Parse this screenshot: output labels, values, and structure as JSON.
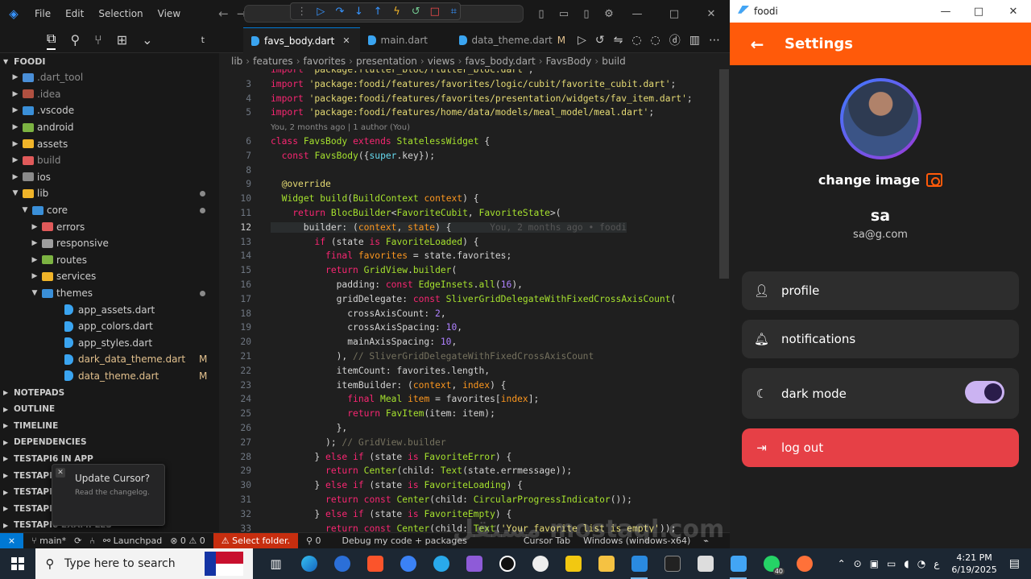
{
  "titlebar": {
    "menu": [
      "File",
      "Edit",
      "Selection",
      "View"
    ]
  },
  "sidebar": {
    "project": "FOODI",
    "tree": [
      {
        "label": ".dart_tool",
        "depth": 1,
        "type": "folder",
        "color": "#4a8fd8",
        "dim": true
      },
      {
        "label": ".idea",
        "depth": 1,
        "type": "folder",
        "color": "#b05040",
        "dim": true
      },
      {
        "label": ".vscode",
        "depth": 1,
        "type": "folder",
        "color": "#3a8fd8"
      },
      {
        "label": "android",
        "depth": 1,
        "type": "folder",
        "color": "#7cb342"
      },
      {
        "label": "assets",
        "depth": 1,
        "type": "folder",
        "color": "#f0b429"
      },
      {
        "label": "build",
        "depth": 1,
        "type": "folder",
        "color": "#e05a5a",
        "dim": true
      },
      {
        "label": "ios",
        "depth": 1,
        "type": "folder",
        "color": "#8a8a8a"
      },
      {
        "label": "lib",
        "depth": 1,
        "type": "folder-open",
        "color": "#f0b429",
        "dot": true
      },
      {
        "label": "core",
        "depth": 2,
        "type": "folder-open",
        "color": "#3a8fd8",
        "dot": true
      },
      {
        "label": "errors",
        "depth": 3,
        "type": "folder",
        "color": "#e05a5a"
      },
      {
        "label": "responsive",
        "depth": 3,
        "type": "folder",
        "color": "#9e9e9e"
      },
      {
        "label": "routes",
        "depth": 3,
        "type": "folder",
        "color": "#7cb342"
      },
      {
        "label": "services",
        "depth": 3,
        "type": "folder",
        "color": "#f0b429"
      },
      {
        "label": "themes",
        "depth": 3,
        "type": "folder-open",
        "color": "#3a8fd8",
        "dot": true
      },
      {
        "label": "app_assets.dart",
        "depth": 4,
        "type": "dart"
      },
      {
        "label": "app_colors.dart",
        "depth": 4,
        "type": "dart"
      },
      {
        "label": "app_styles.dart",
        "depth": 4,
        "type": "dart"
      },
      {
        "label": "dark_data_theme.dart",
        "depth": 4,
        "type": "dart",
        "mod": "M"
      },
      {
        "label": "data_theme.dart",
        "depth": 4,
        "type": "dart",
        "mod": "M"
      }
    ],
    "sections": [
      "NOTEPADS",
      "OUTLINE",
      "TIMELINE",
      "DEPENDENCIES",
      "TESTAPI6 IN APP",
      "TESTAPI6 PROFILE",
      "TESTAPI6 HISTORY",
      "TESTAPI6",
      "TESTAPI6 EXAMPLES"
    ]
  },
  "notification": {
    "title": "Update Cursor?",
    "subtitle": "Read the changelog."
  },
  "tabs": [
    {
      "label": "favs_body.dart",
      "active": true,
      "close": "✕"
    },
    {
      "label": "main.dart",
      "active": false
    },
    {
      "label": "data_theme.dart",
      "active": false,
      "mod": "M"
    }
  ],
  "breadcrumb": [
    "lib",
    "features",
    "favorites",
    "presentation",
    "views",
    "favs_body.dart",
    "FavsBody",
    "build"
  ],
  "code": {
    "codelens": "You, 2 months ago | 1 author (You)",
    "blame": "You, 2 months ago • foodi",
    "current_line": "12",
    "lines": [
      {
        "n": "",
        "html": "<span class='kw'>import</span> <span class='str'>'package:flutter_bloc/flutter_bloc.dart'</span>;"
      },
      {
        "n": "3",
        "html": "<span class='kw'>import</span> <span class='str'>'package:foodi/features/favorites/logic/cubit/favorite_cubit.dart'</span>;"
      },
      {
        "n": "4",
        "html": "<span class='kw'>import</span> <span class='str'>'package:foodi/features/favorites/presentation/widgets/fav_item.dart'</span>;"
      },
      {
        "n": "5",
        "html": "<span class='kw'>import</span> <span class='str'>'package:foodi/features/home/data/models/meal_model/meal.dart'</span>;"
      },
      {
        "n": "",
        "lens": true
      },
      {
        "n": "6",
        "html": "<span class='kw'>class</span> <span class='cls'>FavsBody</span> <span class='kw'>extends</span> <span class='cls'>StatelessWidget</span> {"
      },
      {
        "n": "7",
        "html": "  <span class='kw'>const</span> <span class='fn'>FavsBody</span>({<span class='kw2'>super</span>.key});"
      },
      {
        "n": "8",
        "html": ""
      },
      {
        "n": "9",
        "html": "  <span class='str'>@override</span>"
      },
      {
        "n": "10",
        "html": "  <span class='cls'>Widget</span> <span class='fn'>build</span>(<span class='cls'>BuildContext</span> <span class='prm'>context</span>) {"
      },
      {
        "n": "11",
        "html": "    <span class='kw'>return</span> <span class='cls'>BlocBuilder</span>&lt;<span class='cls'>FavoriteCubit</span>, <span class='cls'>FavoriteState</span>&gt;("
      },
      {
        "n": "12",
        "html": "      builder: (<span class='prm'>context</span>, <span class='prm'>state</span>) {       <span class='ghost'>You, 2 months ago • foodi</span>",
        "cur": true
      },
      {
        "n": "13",
        "html": "        <span class='kw'>if</span> (state <span class='kw'>is</span> <span class='cls'>FavoriteLoaded</span>) {"
      },
      {
        "n": "14",
        "html": "          <span class='kw'>final</span> <span class='prm'>favorites</span> = state.favorites;"
      },
      {
        "n": "15",
        "html": "          <span class='kw'>return</span> <span class='cls'>GridView</span>.<span class='fn'>builder</span>("
      },
      {
        "n": "16",
        "html": "            padding: <span class='kw'>const</span> <span class='cls'>EdgeInsets</span>.<span class='fn'>all</span>(<span class='num'>16</span>),"
      },
      {
        "n": "17",
        "html": "            gridDelegate: <span class='kw'>const</span> <span class='cls'>SliverGridDelegateWithFixedCrossAxisCount</span>("
      },
      {
        "n": "18",
        "html": "              crossAxisCount: <span class='num'>2</span>,"
      },
      {
        "n": "19",
        "html": "              crossAxisSpacing: <span class='num'>10</span>,"
      },
      {
        "n": "20",
        "html": "              mainAxisSpacing: <span class='num'>10</span>,"
      },
      {
        "n": "21",
        "html": "            ), <span class='cm'>// SliverGridDelegateWithFixedCrossAxisCount</span>"
      },
      {
        "n": "22",
        "html": "            itemCount: favorites.length,"
      },
      {
        "n": "23",
        "html": "            itemBuilder: (<span class='prm'>context</span>, <span class='prm'>index</span>) {"
      },
      {
        "n": "24",
        "html": "              <span class='kw'>final</span> <span class='cls'>Meal</span> <span class='prm'>item</span> = favorites[<span class='prm'>index</span>];"
      },
      {
        "n": "25",
        "html": "              <span class='kw'>return</span> <span class='fn'>FavItem</span>(item: item);"
      },
      {
        "n": "26",
        "html": "            },"
      },
      {
        "n": "27",
        "html": "          ); <span class='cm'>// GridView.builder</span>"
      },
      {
        "n": "28",
        "html": "        } <span class='kw'>else if</span> (state <span class='kw'>is</span> <span class='cls'>FavoriteError</span>) {"
      },
      {
        "n": "29",
        "html": "          <span class='kw'>return</span> <span class='fn'>Center</span>(child: <span class='fn'>Text</span>(state.errmessage));"
      },
      {
        "n": "30",
        "html": "        } <span class='kw'>else if</span> (state <span class='kw'>is</span> <span class='cls'>FavoriteLoading</span>) {"
      },
      {
        "n": "31",
        "html": "          <span class='kw'>return</span> <span class='kw'>const</span> <span class='fn'>Center</span>(child: <span class='fn'>CircularProgressIndicator</span>());"
      },
      {
        "n": "32",
        "html": "        } <span class='kw'>else if</span> (state <span class='kw'>is</span> <span class='cls'>FavoriteEmpty</span>) {"
      },
      {
        "n": "33",
        "html": "          <span class='kw'>return</span> <span class='kw'>const</span> <span class='fn'>Center</span>(child: <span class='fn'>Text</span>(<span class='str'>'Your favorite list is empty'</span>));"
      }
    ]
  },
  "statusbar": {
    "branch": "main*",
    "launchpad": "Launchpad",
    "problems": "⊗ 0 ⚠ 0",
    "select_folder": "⚠ Select folder.",
    "ports": "0",
    "debug": "Debug my code + packages",
    "cursor_tab": "Cursor Tab",
    "os": "Windows (windows-x64)"
  },
  "app": {
    "window_title": "foodi",
    "appbar_title": "Settings",
    "change_image": "change image",
    "user_name": "sa",
    "user_email": "sa@g.com",
    "menu": [
      {
        "label": "profile",
        "icon": "person-icon"
      },
      {
        "label": "notifications",
        "icon": "bell-icon"
      },
      {
        "label": "dark mode",
        "icon": "moon-icon",
        "toggle": true,
        "toggle_on": true
      },
      {
        "label": "log out",
        "icon": "logout-icon",
        "danger": true
      }
    ],
    "accent": "#ff5a0a",
    "danger": "#e64046"
  },
  "taskbar": {
    "search_placeholder": "Type here to search",
    "time": "4:21 PM",
    "date": "6/19/2025",
    "whatsapp_badge": "40",
    "lang": "ع"
  },
  "watermark": "مستقل mostaql.com"
}
